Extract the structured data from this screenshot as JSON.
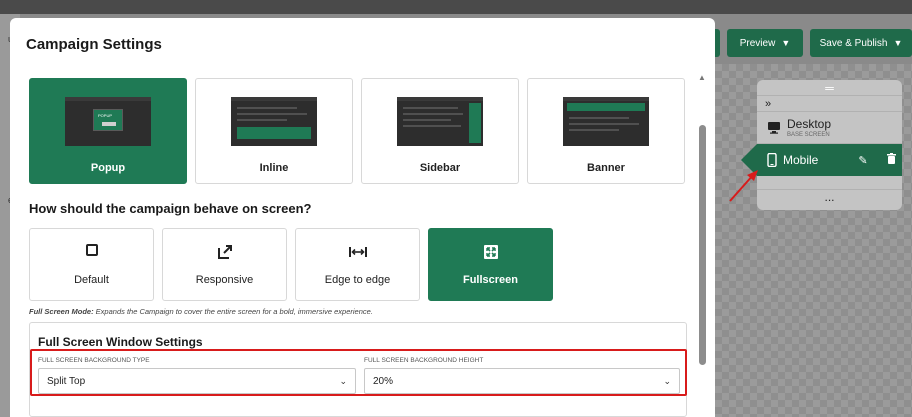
{
  "topbar": {
    "preview_label": "Preview",
    "save_label": "Save & Publish"
  },
  "background": {
    "left_ticks": [
      "ul",
      "e"
    ]
  },
  "device_panel": {
    "handle": "═",
    "collapse": "»",
    "desktop": {
      "label": "Desktop",
      "sublabel": "BASE SCREEN"
    },
    "mobile": {
      "label": "Mobile"
    },
    "more": "..."
  },
  "modal": {
    "title": "Campaign Settings",
    "layouts": [
      {
        "label": "Popup",
        "selected": true,
        "thumb_text": "POPUP"
      },
      {
        "label": "Inline",
        "selected": false
      },
      {
        "label": "Sidebar",
        "selected": false
      },
      {
        "label": "Banner",
        "selected": false
      }
    ],
    "behavior_question": "How should the campaign behave on screen?",
    "modes": [
      {
        "label": "Default",
        "icon": "square-icon",
        "selected": false
      },
      {
        "label": "Responsive",
        "icon": "expand-arrow-icon",
        "selected": false
      },
      {
        "label": "Edge to edge",
        "icon": "horizontal-stretch-icon",
        "selected": false
      },
      {
        "label": "Fullscreen",
        "icon": "fullscreen-arrows-icon",
        "selected": true
      }
    ],
    "hint_label": "Full Screen Mode:",
    "hint_text": " Expands the Campaign to cover the entire screen for a bold, immersive experience.",
    "fullscreen_settings": {
      "title": "Full Screen Window Settings",
      "bg_type_label": "FULL SCREEN BACKGROUND TYPE",
      "bg_type_value": "Split Top",
      "bg_height_label": "FULL SCREEN BACKGROUND HEIGHT",
      "bg_height_value": "20%"
    }
  },
  "colors": {
    "brand_green": "#1f7a55",
    "dark_green": "#1f6a4a",
    "highlight_red": "#d81b1b"
  }
}
